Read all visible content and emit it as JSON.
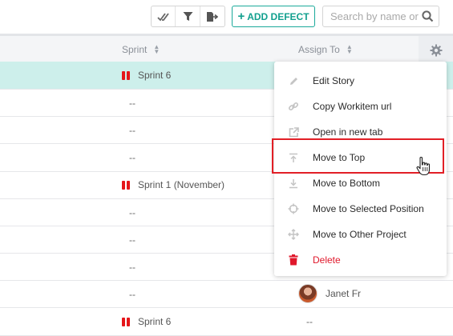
{
  "toolbar": {
    "add_defect_label": "ADD DEFECT",
    "search_placeholder": "Search by name or"
  },
  "grid": {
    "columns": {
      "sprint": "Sprint",
      "assign_to": "Assign To"
    },
    "rows": [
      {
        "sprint": "Sprint 6",
        "assign": ""
      },
      {
        "sprint": "--",
        "assign": ""
      },
      {
        "sprint": "--",
        "assign": ""
      },
      {
        "sprint": "--",
        "assign": ""
      },
      {
        "sprint": "Sprint 1 (November)",
        "assign": ""
      },
      {
        "sprint": "--",
        "assign": ""
      },
      {
        "sprint": "--",
        "assign": ""
      },
      {
        "sprint": "--",
        "assign": ""
      },
      {
        "sprint": "--",
        "assign": "Janet Fr"
      },
      {
        "sprint": "Sprint 6",
        "assign": "--"
      }
    ]
  },
  "context_menu": {
    "items": [
      {
        "label": "Edit Story",
        "icon": "pencil-icon"
      },
      {
        "label": "Copy Workitem url",
        "icon": "link-icon"
      },
      {
        "label": "Open in new tab",
        "icon": "external-link-icon"
      },
      {
        "label": "Move to Top",
        "icon": "move-top-icon"
      },
      {
        "label": "Move to Bottom",
        "icon": "move-bottom-icon"
      },
      {
        "label": "Move to Selected Position",
        "icon": "crosshair-icon"
      },
      {
        "label": "Move to Other Project",
        "icon": "move-arrows-icon"
      },
      {
        "label": "Delete",
        "icon": "trash-icon"
      }
    ]
  },
  "colors": {
    "accent": "#13a08f",
    "selected_row": "#cdefeb",
    "sprint_icon": "#e5161a",
    "delete": "#e0182b",
    "highlight": "#e21f26"
  }
}
